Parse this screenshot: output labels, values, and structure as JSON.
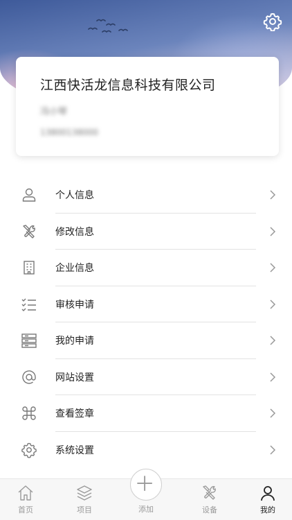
{
  "header": {
    "settings_icon": "gear-icon",
    "decoration": "birds"
  },
  "profile_card": {
    "company_name": "江西快活龙信息科技有限公司",
    "user_name": "冯小琴",
    "phone": "13800138000"
  },
  "menu": {
    "items": [
      {
        "label": "个人信息",
        "icon": "user-icon"
      },
      {
        "label": "修改信息",
        "icon": "tools-icon"
      },
      {
        "label": "企业信息",
        "icon": "building-icon"
      },
      {
        "label": "审核申请",
        "icon": "checklist-icon"
      },
      {
        "label": "我的申请",
        "icon": "list-icon"
      },
      {
        "label": "网站设置",
        "icon": "at-icon"
      },
      {
        "label": "查看签章",
        "icon": "command-icon"
      },
      {
        "label": "系统设置",
        "icon": "settings-icon"
      }
    ]
  },
  "tabbar": {
    "tabs": [
      {
        "label": "首页",
        "icon": "home-icon"
      },
      {
        "label": "项目",
        "icon": "layers-icon"
      },
      {
        "label": "添加",
        "icon": "plus-circle-icon"
      },
      {
        "label": "设备",
        "icon": "tools-icon"
      },
      {
        "label": "我的",
        "icon": "user-icon"
      }
    ],
    "active": "我的",
    "colors": {
      "active": "#222222",
      "inactive": "#9a9a9a"
    }
  }
}
